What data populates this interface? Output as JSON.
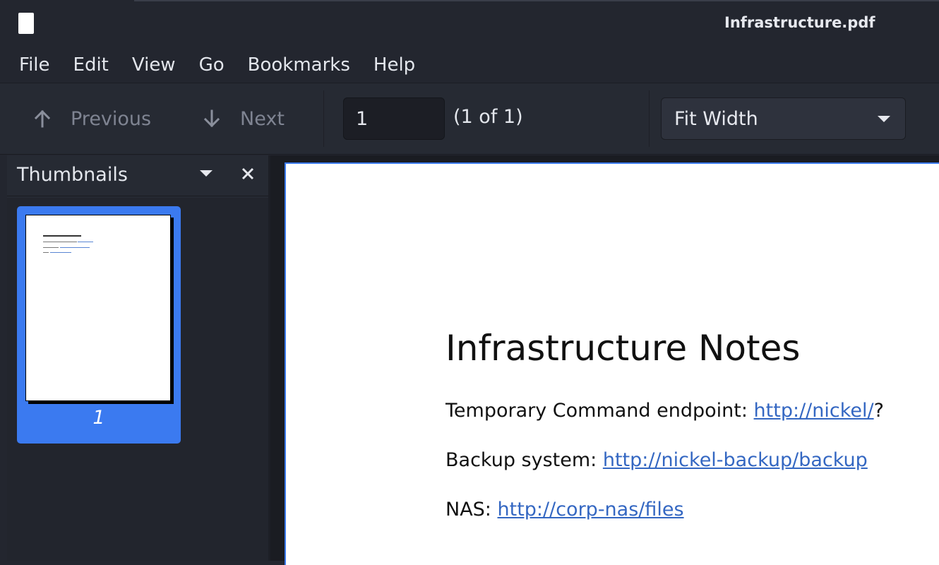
{
  "window": {
    "title": "Infrastructure.pdf"
  },
  "menu": [
    "File",
    "Edit",
    "View",
    "Go",
    "Bookmarks",
    "Help"
  ],
  "toolbar": {
    "previous_label": "Previous",
    "next_label": "Next",
    "page_value": "1",
    "page_count": "(1 of 1)",
    "zoom_value": "Fit Width"
  },
  "sidebar": {
    "title": "Thumbnails",
    "thumbnails": [
      {
        "label": "1",
        "selected": true
      }
    ]
  },
  "document": {
    "title": "Infrastructure Notes",
    "lines": [
      {
        "label": "Temporary Command endpoint: ",
        "link": "http://nickel/",
        "suffix": "?"
      },
      {
        "label": "Backup system: ",
        "link": "http://nickel-backup/backup",
        "suffix": ""
      },
      {
        "label": "NAS: ",
        "link": "http://corp-nas/files",
        "suffix": ""
      }
    ]
  },
  "colors": {
    "accent": "#3b7af0",
    "link": "#3467c2",
    "background": "#23262f"
  },
  "icons": {
    "app": "document-icon",
    "previous": "arrow-up-icon",
    "next": "arrow-down-icon",
    "dropdown": "chevron-down-icon",
    "close": "close-icon"
  }
}
